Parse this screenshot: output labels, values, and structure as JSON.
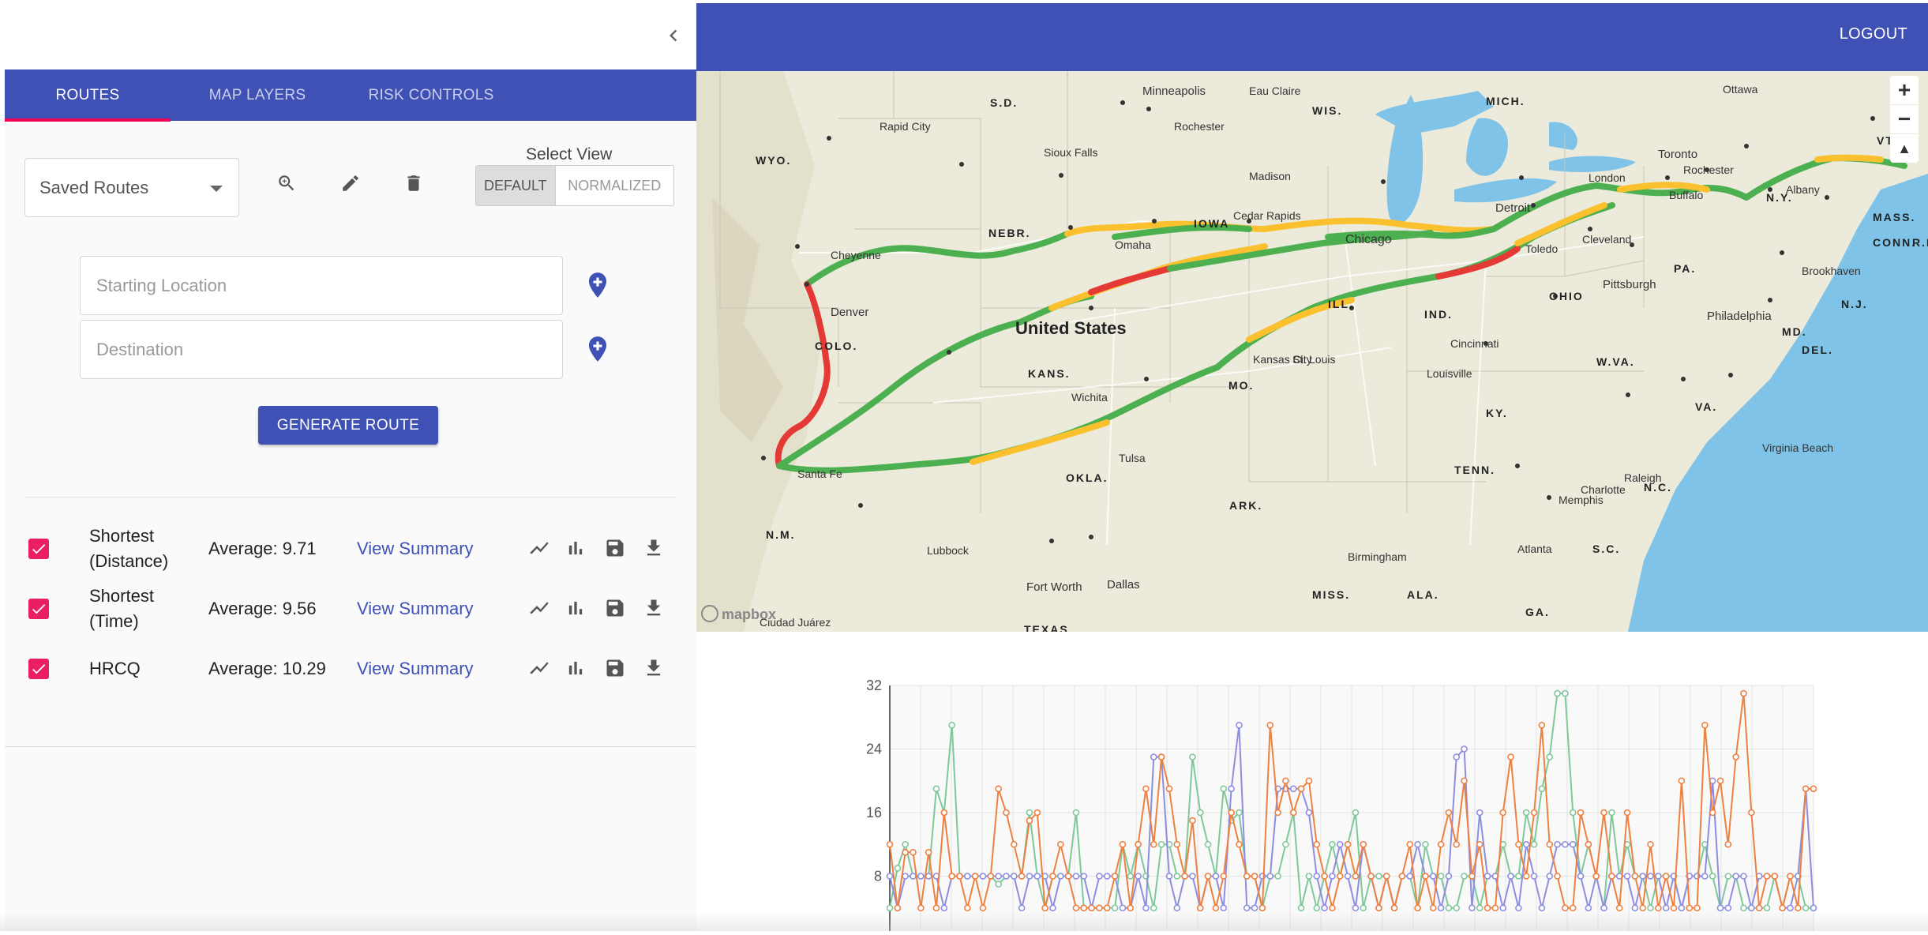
{
  "header": {
    "logout_label": "LOGOUT"
  },
  "tabs": [
    {
      "label": "ROUTES",
      "active": true
    },
    {
      "label": "MAP LAYERS",
      "active": false
    },
    {
      "label": "RISK CONTROLS",
      "active": false
    }
  ],
  "toolbar": {
    "saved_routes": "Saved Routes",
    "select_view_label": "Select View",
    "view_options": [
      "DEFAULT",
      "NORMALIZED"
    ],
    "selected_view": "DEFAULT",
    "icons": [
      "search-icon",
      "edit-icon",
      "delete-icon"
    ]
  },
  "inputs": {
    "start_placeholder": "Starting Location",
    "destination_placeholder": "Destination"
  },
  "generate_label": "GENERATE ROUTE",
  "routes": [
    {
      "name": "Shortest (Distance)",
      "average": "Average: 9.71",
      "summary": "View Summary",
      "checked": true
    },
    {
      "name": "Shortest (Time)",
      "average": "Average: 9.56",
      "summary": "View Summary",
      "checked": true
    },
    {
      "name": "HRCQ",
      "average": "Average: 10.29",
      "summary": "View Summary",
      "checked": true
    }
  ],
  "colors": {
    "primary": "#3f51b5",
    "accent": "#e91e63",
    "risk_low": "#4caf50",
    "risk_mid": "#fbc02d",
    "risk_high": "#e53935",
    "series_green": "#7ec89a",
    "series_purple": "#8e8ee0",
    "series_orange": "#ee8040"
  },
  "map": {
    "country_label": "United States",
    "attribution": "mapbox",
    "city_labels": [
      "Minneapolis",
      "Eau Claire",
      "Rochester",
      "Rapid City",
      "Sioux Falls",
      "Madison",
      "Cedar Rapids",
      "Omaha",
      "Chicago",
      "Cheyenne",
      "Denver",
      "Kansas City",
      "Wichita",
      "St. Louis",
      "Tulsa",
      "Santa Fe",
      "Lubbock",
      "Fort Worth",
      "Dallas",
      "Memphis",
      "Birmingham",
      "Atlanta",
      "Charlotte",
      "Raleigh",
      "Virginia Beach",
      "Philadelphia",
      "Brookhaven",
      "Pittsburgh",
      "Cincinnati",
      "Louisville",
      "Detroit",
      "London",
      "Toronto",
      "Rochester",
      "Buffalo",
      "Albany",
      "Ottawa",
      "Toledo",
      "Cleveland",
      "Ciudad Juárez"
    ],
    "state_labels": [
      "S.D.",
      "WYO.",
      "NEBR.",
      "IOWA",
      "WIS.",
      "MICH.",
      "COLO.",
      "KANS.",
      "MO.",
      "ILL.",
      "IND.",
      "OHIO",
      "PA.",
      "N.Y.",
      "VT.",
      "MASS.",
      "CONN.",
      "R.I.",
      "N.J.",
      "MD.",
      "DEL.",
      "W.VA.",
      "VA.",
      "KY.",
      "TENN.",
      "N.C.",
      "S.C.",
      "GA.",
      "ALA.",
      "MISS.",
      "ARK.",
      "OKLA.",
      "N.M.",
      "TEXAS"
    ]
  },
  "chart_data": {
    "type": "line",
    "y_ticks": [
      8,
      16,
      24,
      32
    ],
    "ylim": [
      0,
      32
    ],
    "x_count": 120,
    "grid": true,
    "series": [
      {
        "color": "#7ec89a",
        "values": [
          4,
          9,
          12,
          8,
          8,
          8,
          19,
          16,
          27,
          8,
          8,
          8,
          8,
          8,
          7,
          8,
          8,
          8,
          16,
          8,
          4,
          8,
          8,
          8,
          16,
          4,
          4,
          4,
          4,
          4,
          12,
          8,
          12,
          8,
          4,
          12,
          12,
          8,
          8,
          23,
          16,
          12,
          8,
          19,
          15,
          16,
          8,
          8,
          4,
          8,
          8,
          12,
          16,
          4,
          8,
          4,
          8,
          12,
          8,
          12,
          16,
          4,
          8,
          8,
          8,
          4,
          8,
          8,
          4,
          12,
          8,
          8,
          4,
          4,
          8,
          8,
          4,
          8,
          8,
          12,
          8,
          8,
          16,
          12,
          19,
          23,
          31,
          31,
          16,
          8,
          12,
          8,
          4,
          16,
          8,
          12,
          8,
          8,
          4,
          8,
          8,
          8,
          4,
          8,
          8,
          12,
          8,
          4,
          8,
          8,
          4,
          4,
          4,
          4,
          8,
          4,
          8,
          8,
          4,
          4
        ]
      },
      {
        "color": "#8e8ee0",
        "values": [
          8,
          4,
          8,
          8,
          8,
          8,
          8,
          4,
          8,
          8,
          8,
          8,
          8,
          8,
          8,
          8,
          8,
          4,
          8,
          8,
          8,
          4,
          8,
          8,
          8,
          8,
          4,
          8,
          8,
          8,
          4,
          4,
          8,
          4,
          23,
          23,
          8,
          4,
          8,
          8,
          4,
          8,
          8,
          4,
          19,
          27,
          4,
          4,
          8,
          8,
          19,
          19,
          19,
          19,
          16,
          8,
          4,
          8,
          12,
          8,
          4,
          12,
          8,
          4,
          8,
          4,
          8,
          8,
          12,
          8,
          8,
          4,
          8,
          23,
          24,
          4,
          16,
          8,
          8,
          4,
          8,
          4,
          12,
          8,
          4,
          8,
          12,
          12,
          12,
          8,
          4,
          8,
          4,
          8,
          8,
          8,
          4,
          8,
          8,
          8,
          4,
          8,
          4,
          8,
          8,
          8,
          20,
          4,
          4,
          8,
          8,
          4,
          8,
          8,
          8,
          4,
          4,
          8,
          19,
          4
        ]
      },
      {
        "color": "#ee8040",
        "values": [
          12,
          4,
          11,
          11,
          4,
          11,
          4,
          16,
          8,
          8,
          4,
          8,
          4,
          8,
          19,
          16,
          12,
          8,
          15,
          16,
          4,
          8,
          12,
          8,
          4,
          4,
          4,
          4,
          4,
          8,
          12,
          4,
          12,
          19,
          12,
          23,
          19,
          12,
          8,
          15,
          4,
          8,
          4,
          8,
          16,
          12,
          8,
          8,
          4,
          27,
          16,
          20,
          16,
          19,
          20,
          12,
          8,
          4,
          8,
          12,
          8,
          12,
          8,
          4,
          8,
          4,
          8,
          12,
          4,
          8,
          4,
          12,
          16,
          12,
          20,
          8,
          12,
          4,
          4,
          16,
          23,
          12,
          8,
          16,
          27,
          12,
          8,
          4,
          4,
          16,
          12,
          8,
          16,
          8,
          4,
          16,
          8,
          4,
          12,
          4,
          8,
          4,
          20,
          4,
          4,
          27,
          16,
          20,
          12,
          23,
          31,
          16,
          4,
          8,
          8,
          4,
          8,
          4,
          19,
          19
        ]
      }
    ]
  }
}
